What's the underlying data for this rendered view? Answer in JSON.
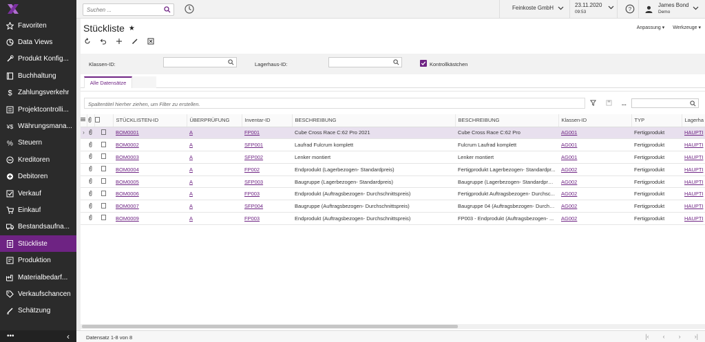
{
  "sidebar": {
    "items": [
      {
        "label": "Favoriten",
        "icon": "star-icon"
      },
      {
        "label": "Data Views",
        "icon": "pie-chart-icon"
      },
      {
        "label": "Produkt Konfig...",
        "icon": "wrench-icon"
      },
      {
        "label": "Buchhaltung",
        "icon": "book-icon"
      },
      {
        "label": "Zahlungsverkehr",
        "icon": "dollar-icon"
      },
      {
        "label": "Projektcontrolli...",
        "icon": "project-icon"
      },
      {
        "label": "Währungsmana...",
        "icon": "currency-icon"
      },
      {
        "label": "Steuern",
        "icon": "percent-icon"
      },
      {
        "label": "Kreditoren",
        "icon": "minus-circle-icon"
      },
      {
        "label": "Debitoren",
        "icon": "plus-circle-icon"
      },
      {
        "label": "Verkauf",
        "icon": "check-box-icon"
      },
      {
        "label": "Einkauf",
        "icon": "cart-icon"
      },
      {
        "label": "Bestandsaufna...",
        "icon": "truck-icon"
      },
      {
        "label": "Stückliste",
        "icon": "list-doc-icon"
      },
      {
        "label": "Produktion",
        "icon": "production-icon"
      },
      {
        "label": "Materialbedarf...",
        "icon": "factory-icon"
      },
      {
        "label": "Verkaufschancen",
        "icon": "tag-icon"
      },
      {
        "label": "Schätzung",
        "icon": "pen-icon"
      }
    ],
    "active_index": 13,
    "footer_more": "•••",
    "footer_collapse": "‹"
  },
  "topbar": {
    "search_placeholder": "Suchen ...",
    "company": "Feinkoste GmbH",
    "date": "23.11.2020",
    "time": "09:53",
    "user_name": "James Bond",
    "user_role": "Demo"
  },
  "header": {
    "title": "Stückliste",
    "star": "★",
    "customization": "Anpassung ▾",
    "tools": "Werkzeuge ▾"
  },
  "filters": {
    "class_label": "Klassen-ID:",
    "warehouse_label": "Lagerhaus-ID:",
    "checkbox_label": "Kontrollkästchen"
  },
  "tabs": {
    "all_records": "Alle Datensätze"
  },
  "grid": {
    "group_hint": "Spaltentitel hierher ziehen, um Filter zu erstellen.",
    "more": "...",
    "columns": [
      "STÜCKLISTEN-ID",
      "ÜBERPRÜFUNG",
      "Inventar-ID",
      "BESCHREIBUNG",
      "BESCHREIBUNG",
      "Klassen-ID",
      "TYP",
      "Lagerha"
    ],
    "rows": [
      {
        "id": "BOM0001",
        "rev": "A",
        "inv": "FP001",
        "desc": "Cube Cross Race C:62 Pro 2021",
        "desc2": "Cube Cross Race C:62 Pro",
        "cls": "AG001",
        "typ": "Fertigprodukt",
        "wh": "HAUPTI"
      },
      {
        "id": "BOM0002",
        "rev": "A",
        "inv": "SFP001",
        "desc": "Laufrad Fulcrum komplett",
        "desc2": "Fulcrum Laufrad komplett",
        "cls": "AG001",
        "typ": "Fertigprodukt",
        "wh": "HAUPTI"
      },
      {
        "id": "BOM0003",
        "rev": "A",
        "inv": "SFP002",
        "desc": "Lenker montiert",
        "desc2": "Lenker montiert",
        "cls": "AG001",
        "typ": "Fertigprodukt",
        "wh": "HAUPTI"
      },
      {
        "id": "BOM0004",
        "rev": "A",
        "inv": "FP002",
        "desc": "Endprodukt (Lagerbezogen- Standardpreis)",
        "desc2": "Fertigprodukt Lagerbezogen- Standardpr...",
        "cls": "AG002",
        "typ": "Fertigprodukt",
        "wh": "HAUPTI"
      },
      {
        "id": "BOM0005",
        "rev": "A",
        "inv": "SFP003",
        "desc": "Baugruppe (Lagerbezogen- Standardpreis)",
        "desc2": "Baugruppe (Lagerbezogen- Standardprei...",
        "cls": "AG002",
        "typ": "Fertigprodukt",
        "wh": "HAUPTI"
      },
      {
        "id": "BOM0006",
        "rev": "A",
        "inv": "FP003",
        "desc": "Endprodukt (Auftragsbezogen- Durchschnittspreis)",
        "desc2": "Fertigprodukt Auftragsbezogen- Durchsc...",
        "cls": "AG002",
        "typ": "Fertigprodukt",
        "wh": "HAUPTI"
      },
      {
        "id": "BOM0007",
        "rev": "A",
        "inv": "SFP004",
        "desc": "Baugruppe (Auftragsbezogen- Durchschnittspreis)",
        "desc2": "Baugruppe 04 (Auftragsbezogen- Durchs...",
        "cls": "AG002",
        "typ": "Fertigprodukt",
        "wh": "HAUPTI"
      },
      {
        "id": "BOM0009",
        "rev": "A",
        "inv": "FP003",
        "desc": "Endprodukt (Auftragsbezogen- Durchschnittspreis)",
        "desc2": "FP003 - Endprodukt (Auftragsbezogen- ...",
        "cls": "AG002",
        "typ": "Fertigprodukt",
        "wh": "HAUPTI"
      }
    ],
    "selected_index": 0
  },
  "footer": {
    "record_count": "Datensatz 1-8 von 8"
  },
  "colors": {
    "accent": "#6e2383",
    "sidebar_bg": "#2b2b2b"
  }
}
